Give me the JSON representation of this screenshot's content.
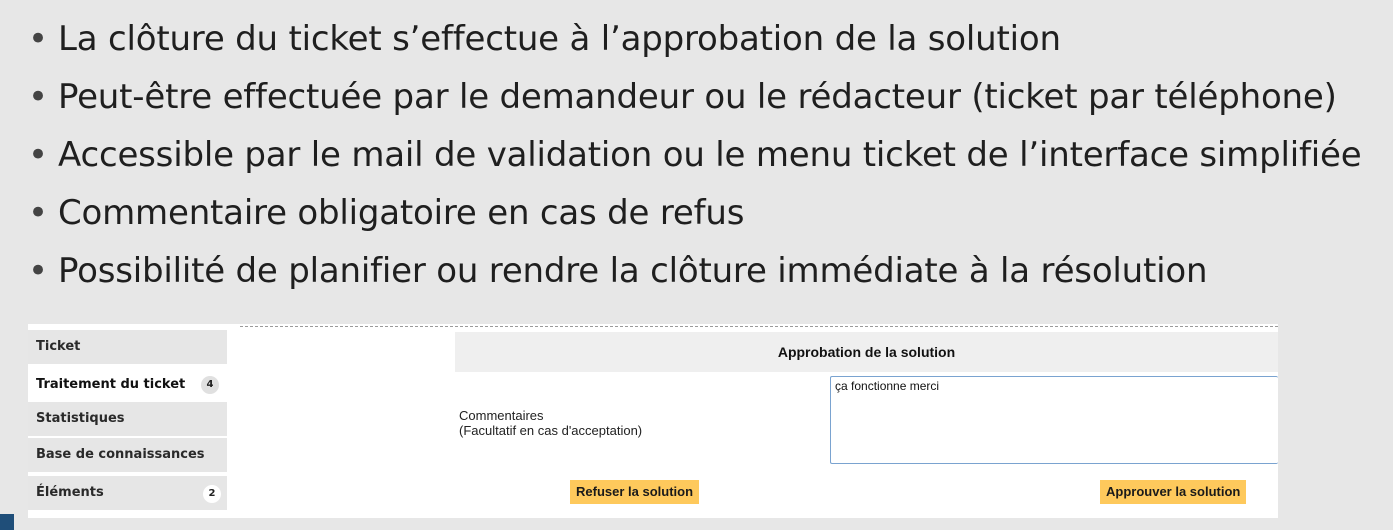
{
  "bullets": [
    "La clôture du ticket s’effectue à l’approbation de la solution",
    "Peut-être effectuée par le demandeur ou le rédacteur (ticket par téléphone)",
    "Accessible par le mail de validation ou le menu ticket de l’interface simplifiée",
    "Commentaire obligatoire en cas de refus",
    "Possibilité de planifier ou rendre la clôture immédiate à la résolution"
  ],
  "bullet_glyph": "•",
  "sidebar": {
    "items": [
      {
        "label": "Ticket",
        "badge": ""
      },
      {
        "label": "Traitement du ticket",
        "badge": "4"
      },
      {
        "label": "Statistiques",
        "badge": ""
      },
      {
        "label": "Base de connaissances",
        "badge": ""
      },
      {
        "label": "Éléments",
        "badge": "2"
      }
    ]
  },
  "approval": {
    "title": "Approbation de la solution",
    "comment_label_line1": "Commentaires",
    "comment_label_line2": "(Facultatif en cas d'acceptation)",
    "comment_value": "ça fonctionne merci",
    "refuse_button": "Refuser la solution",
    "approve_button": "Approuver la solution"
  },
  "colors": {
    "background": "#e7e7e7",
    "button_accent": "#fec95c",
    "input_border": "#7aa3d0",
    "slide_accent": "#1f4e79"
  }
}
